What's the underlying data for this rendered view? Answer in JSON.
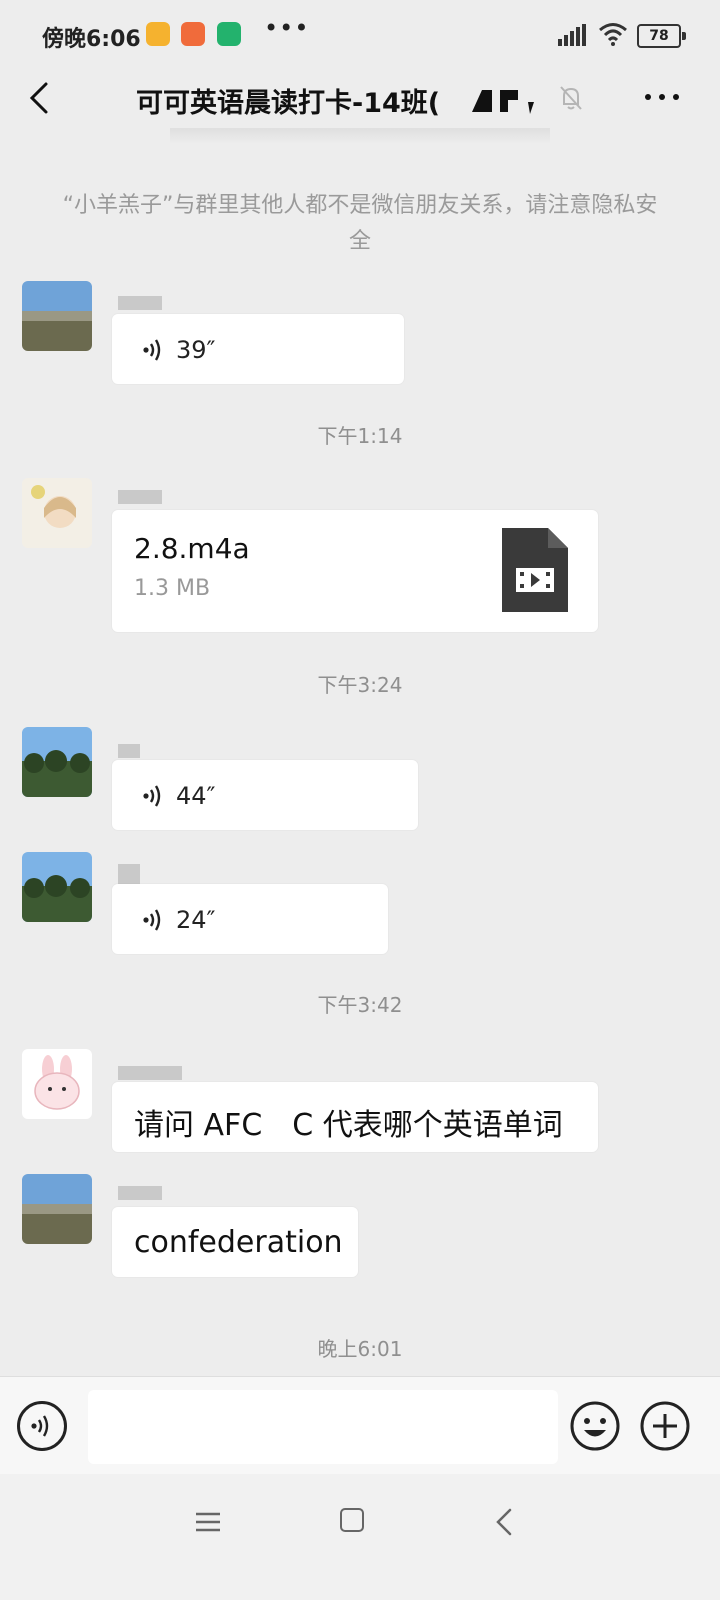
{
  "status_bar": {
    "time": "傍晚6:06",
    "battery": "78",
    "more": "•••"
  },
  "header": {
    "title": "可可英语晨读打卡-14班("
  },
  "notice": "“小羊羔子”与群里其他人都不是微信朋友关系，请注意隐私安全",
  "messages": {
    "m1": {
      "type": "voice",
      "duration": "39″"
    },
    "ts1": "下午1:14",
    "m2": {
      "type": "file",
      "file_name": "2.8.m4a",
      "file_size": "1.3 MB"
    },
    "ts2": "下午3:24",
    "m3": {
      "type": "voice",
      "duration": "44″"
    },
    "m4": {
      "type": "voice",
      "duration": "24″"
    },
    "ts3": "下午3:42",
    "m5": {
      "type": "text",
      "text": "请问 AFC　C 代表哪个英语单词"
    },
    "m6": {
      "type": "text",
      "text": "confederation"
    },
    "ts4": "晚上6:01"
  },
  "input": {
    "placeholder": ""
  },
  "icons": {
    "back": "back-arrow-icon",
    "mute": "mute-bell-icon",
    "more": "more-dots-icon",
    "voice": "voice-icon",
    "emoji": "emoji-icon",
    "plus": "plus-icon",
    "file": "video-file-icon"
  },
  "colors": {
    "background": "#ededed",
    "bubble": "#ffffff",
    "muted_text": "#9a9a9a"
  }
}
